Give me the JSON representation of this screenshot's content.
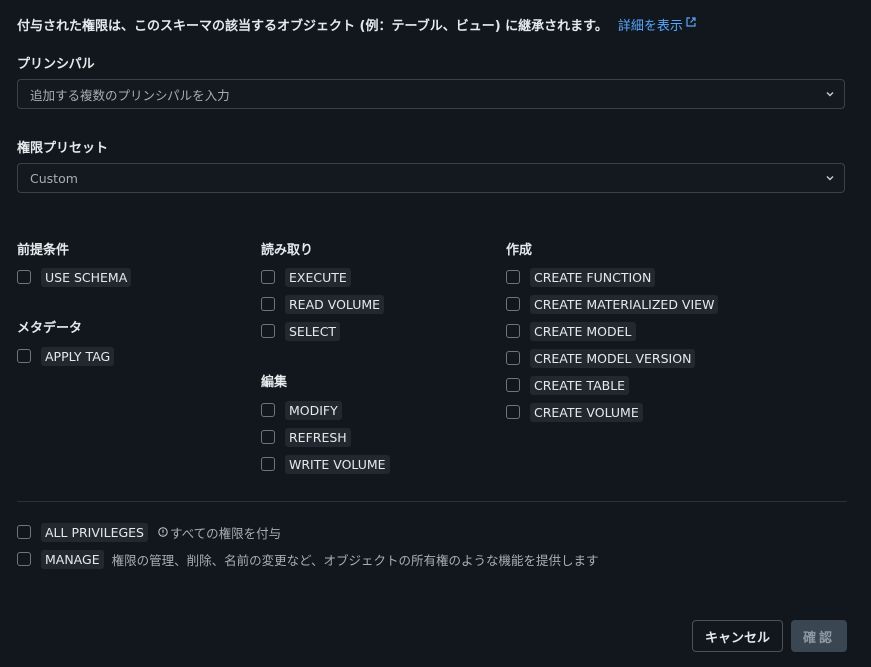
{
  "info": {
    "text": "付与された権限は、このスキーマの該当するオブジェクト (例：テーブル、ビュー) に継承されます。",
    "link": "詳細を表示"
  },
  "principal": {
    "label": "プリンシパル",
    "placeholder": "追加する複数のプリンシパルを入力"
  },
  "preset": {
    "label": "権限プリセット",
    "value": "Custom"
  },
  "groups": {
    "prereq": {
      "title": "前提条件",
      "items": [
        "USE SCHEMA"
      ]
    },
    "metadata": {
      "title": "メタデータ",
      "items": [
        "APPLY TAG"
      ]
    },
    "read": {
      "title": "読み取り",
      "items": [
        "EXECUTE",
        "READ VOLUME",
        "SELECT"
      ]
    },
    "edit": {
      "title": "編集",
      "items": [
        "MODIFY",
        "REFRESH",
        "WRITE VOLUME"
      ]
    },
    "create": {
      "title": "作成",
      "items": [
        "CREATE FUNCTION",
        "CREATE MATERIALIZED VIEW",
        "CREATE MODEL",
        "CREATE MODEL VERSION",
        "CREATE TABLE",
        "CREATE VOLUME"
      ]
    }
  },
  "bottom": {
    "all_privileges": {
      "label": "ALL PRIVILEGES",
      "desc": "すべての権限を付与"
    },
    "manage": {
      "label": "MANAGE",
      "desc": "権限の管理、削除、名前の変更など、オブジェクトの所有権のような機能を提供します"
    }
  },
  "buttons": {
    "cancel": "キャンセル",
    "confirm": "確認"
  },
  "colors": {
    "link": "#58a6ff",
    "background": "#12171d",
    "tag_bg": "#22282f"
  },
  "icons": {
    "external_link": "external-link-icon",
    "chevron": "chevron-down-icon",
    "info": "info-icon"
  }
}
